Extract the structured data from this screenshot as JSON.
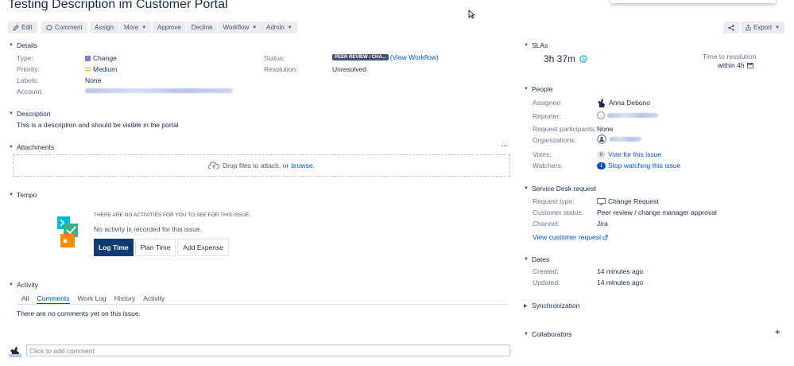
{
  "issue": {
    "title": "Testing Description im Customer Portal"
  },
  "toolbar": {
    "edit": "Edit",
    "comment": "Comment",
    "assign": "Assign",
    "more": "More",
    "approve": "Approve",
    "decline": "Decline",
    "workflow": "Workflow",
    "admin": "Admin",
    "export": "Export"
  },
  "details": {
    "heading": "Details",
    "type_label": "Type:",
    "type_value": "Change",
    "priority_label": "Priority:",
    "priority_value": "Medium",
    "labels_label": "Labels:",
    "labels_value": "None",
    "account_label": "Account:",
    "status_label": "Status:",
    "status_value": "PEER REVIEW / CHA...",
    "view_workflow": "(View Workflow)",
    "resolution_label": "Resolution:",
    "resolution_value": "Unresolved"
  },
  "description": {
    "heading": "Description",
    "text": "This is a description and should be visible in the portal"
  },
  "attachments": {
    "heading": "Attachments",
    "more": "···",
    "drop_text": "Drop files to attach, or",
    "browse": "browse."
  },
  "tempo": {
    "heading": "Tempo",
    "notice": "THERE ARE NO ACTIVITIES FOR YOU TO SEE FOR THIS ISSUE.",
    "no_activity": "No activity is recorded for this issue.",
    "log_time": "Log Time",
    "plan_time": "Plan Time",
    "add_expense": "Add Expense"
  },
  "activity": {
    "heading": "Activity",
    "tabs": [
      "All",
      "Comments",
      "Work Log",
      "History",
      "Activity"
    ],
    "active_tab": "Comments",
    "empty": "There are no comments yet on this issue."
  },
  "comment_box": {
    "placeholder": "Click to add comment"
  },
  "slas": {
    "heading": "SLAs",
    "time": "3h 37m",
    "label_line1": "Time to resolution",
    "label_line2": "within 4h"
  },
  "people": {
    "heading": "People",
    "assignee_label": "Assignee:",
    "assignee_value": "Anna Debono",
    "reporter_label": "Reporter:",
    "participants_label": "Request participants:",
    "participants_value": "None",
    "organizations_label": "Organizations:",
    "votes_label": "Votes:",
    "votes_count": "0",
    "votes_link": "Vote for this issue",
    "watchers_label": "Watchers:",
    "watchers_count": "1",
    "watchers_link": "Stop watching this issue"
  },
  "service_desk": {
    "heading": "Service Desk request",
    "type_label": "Request type:",
    "type_value": "Change Request",
    "status_label": "Customer status:",
    "status_value": "Peer review / change manager approval",
    "channel_label": "Channel:",
    "channel_value": "Jira",
    "view_link": "View customer request"
  },
  "dates": {
    "heading": "Dates",
    "created_label": "Created:",
    "created_value": "14 minutes ago",
    "updated_label": "Updated:",
    "updated_value": "14 minutes ago"
  },
  "synchronization": {
    "heading": "Synchronization"
  },
  "collaborators": {
    "heading": "Collaborators",
    "add": "+"
  },
  "colors": {
    "link": "#0052cc",
    "button_bg": "#ebecf0",
    "log_time_bg": "#0c3c71",
    "text": "#172b4d",
    "label": "#6b778c"
  }
}
